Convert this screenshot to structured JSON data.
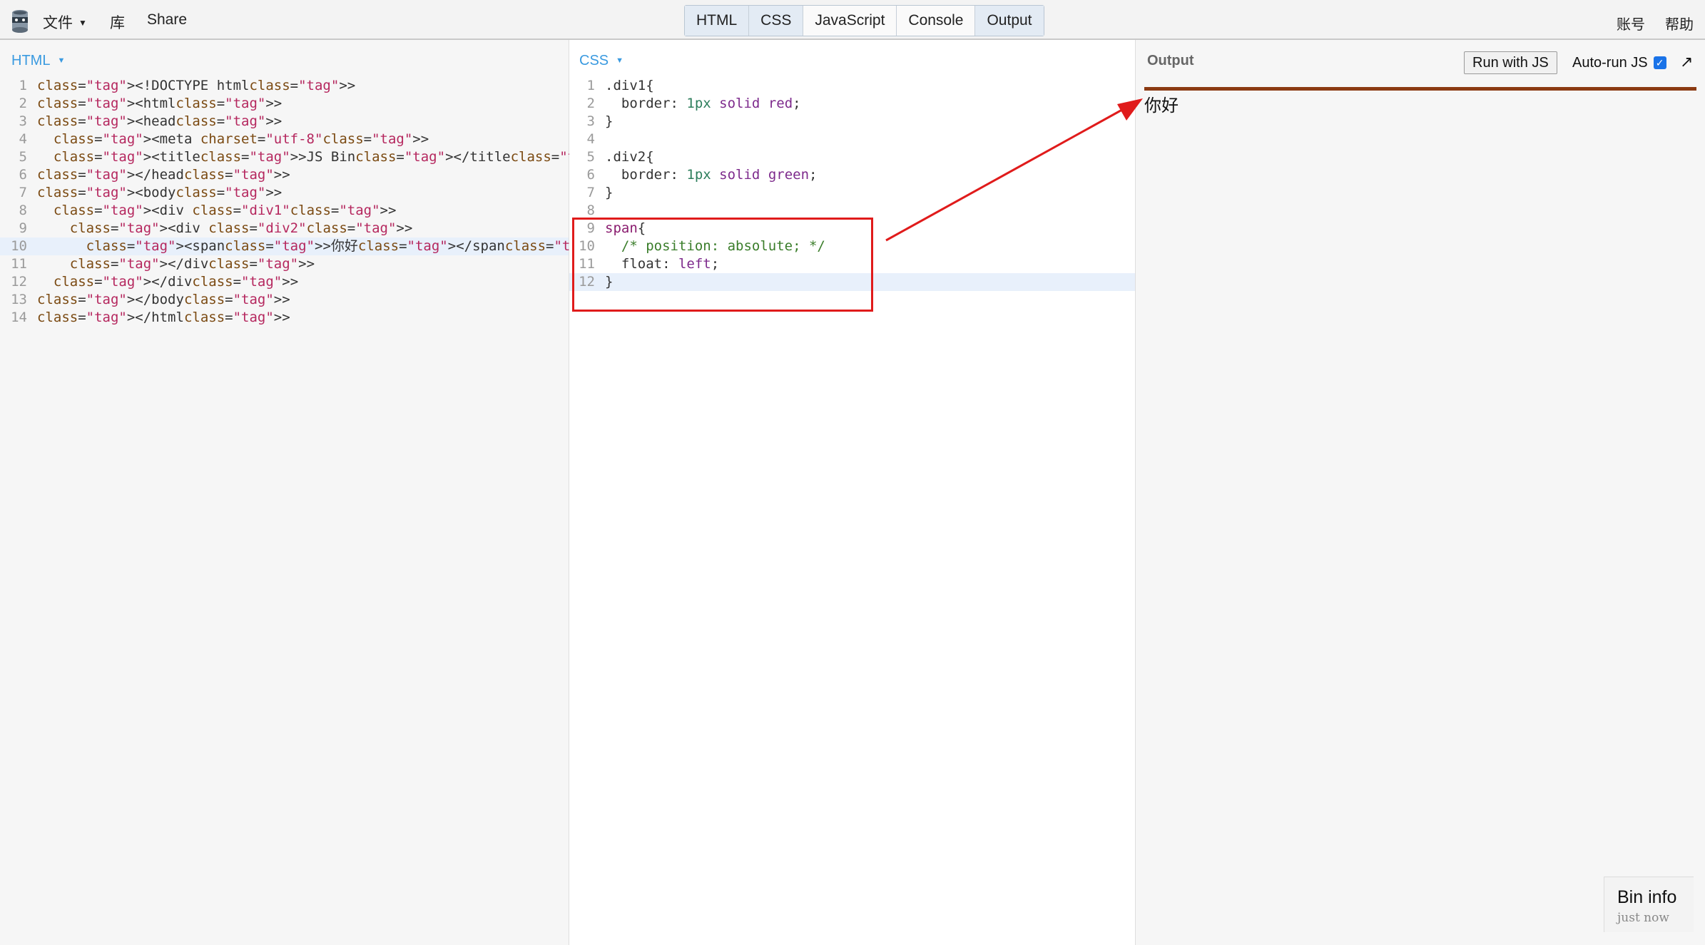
{
  "topbar": {
    "menu": {
      "file_label": "文件",
      "library_label": "库",
      "share_label": "Share"
    },
    "tabs": [
      "HTML",
      "CSS",
      "JavaScript",
      "Console",
      "Output"
    ],
    "account_label": "账号",
    "help_label": "帮助"
  },
  "html_panel": {
    "label": "HTML",
    "highlighted_line": 10,
    "lines": [
      {
        "n": "1",
        "text": "<!DOCTYPE html>"
      },
      {
        "n": "2",
        "text": "<html>"
      },
      {
        "n": "3",
        "text": "<head>"
      },
      {
        "n": "4",
        "text": "  <meta charset=\"utf-8\">"
      },
      {
        "n": "5",
        "text": "  <title>JS Bin</title>"
      },
      {
        "n": "6",
        "text": "</head>"
      },
      {
        "n": "7",
        "text": "<body>"
      },
      {
        "n": "8",
        "text": "  <div class=\"div1\">"
      },
      {
        "n": "9",
        "text": "    <div class=\"div2\">"
      },
      {
        "n": "10",
        "text": "      <span>你好</span>"
      },
      {
        "n": "11",
        "text": "    </div>"
      },
      {
        "n": "12",
        "text": "  </div>"
      },
      {
        "n": "13",
        "text": "</body>"
      },
      {
        "n": "14",
        "text": "</html>"
      }
    ]
  },
  "css_panel": {
    "label": "CSS",
    "highlighted_line": 12,
    "lines": [
      {
        "n": "1",
        "text": ".div1{"
      },
      {
        "n": "2",
        "text": "  border: 1px solid red;"
      },
      {
        "n": "3",
        "text": "}"
      },
      {
        "n": "4",
        "text": ""
      },
      {
        "n": "5",
        "text": ".div2{"
      },
      {
        "n": "6",
        "text": "  border: 1px solid green;"
      },
      {
        "n": "7",
        "text": "}"
      },
      {
        "n": "8",
        "text": ""
      },
      {
        "n": "9",
        "text": "span{"
      },
      {
        "n": "10",
        "text": "  /* position: absolute; */"
      },
      {
        "n": "11",
        "text": "  float: left;"
      },
      {
        "n": "12",
        "text": "}"
      }
    ]
  },
  "output_panel": {
    "title": "Output",
    "run_button_label": "Run with JS",
    "autorun_label": "Auto-run JS",
    "autorun_checked": true,
    "popout_icon": "↗",
    "rendered_text": "你好"
  },
  "bin_info": {
    "title": "Bin info",
    "time": "just now"
  },
  "annotation": {
    "color": "#e01b1b"
  },
  "colors": {
    "accent": "#3a9ae0",
    "tag": "#8a1c6f",
    "string": "#b5275e",
    "output_border": "#8b3a12"
  }
}
